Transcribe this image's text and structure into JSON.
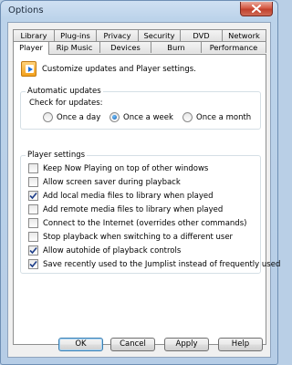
{
  "window": {
    "title": "Options"
  },
  "tabs_back": [
    "Library",
    "Plug-ins",
    "Privacy",
    "Security",
    "DVD",
    "Network"
  ],
  "tabs_front": [
    "Player",
    "Rip Music",
    "Devices",
    "Burn",
    "Performance"
  ],
  "header": {
    "text": "Customize updates and Player settings."
  },
  "automatic_updates": {
    "group_label": "Automatic updates",
    "check_label": "Check for updates:",
    "options": [
      {
        "label": "Once a day",
        "selected": false
      },
      {
        "label": "Once a week",
        "selected": true
      },
      {
        "label": "Once a month",
        "selected": false
      }
    ]
  },
  "player_settings": {
    "group_label": "Player settings",
    "items": [
      {
        "label": "Keep Now Playing on top of other windows",
        "checked": false
      },
      {
        "label": "Allow screen saver during playback",
        "checked": false
      },
      {
        "label": "Add local media files to library when played",
        "checked": true
      },
      {
        "label": "Add remote media files to library when played",
        "checked": false
      },
      {
        "label": "Connect to the Internet (overrides other commands)",
        "checked": false
      },
      {
        "label": "Stop playback when switching to a different user",
        "checked": false
      },
      {
        "label": "Allow autohide of playback controls",
        "checked": true
      },
      {
        "label": "Save recently used to the Jumplist instead of frequently used",
        "checked": true
      }
    ]
  },
  "buttons": {
    "ok": "OK",
    "cancel": "Cancel",
    "apply": "Apply",
    "help": "Help"
  },
  "icons": {
    "close": "close-icon",
    "player": "media-player-icon",
    "check": "checkmark-icon"
  },
  "colors": {
    "close_button": "#c94a36",
    "radio_fill": "#1659a8",
    "default_button_border": "#3c7fb1"
  }
}
